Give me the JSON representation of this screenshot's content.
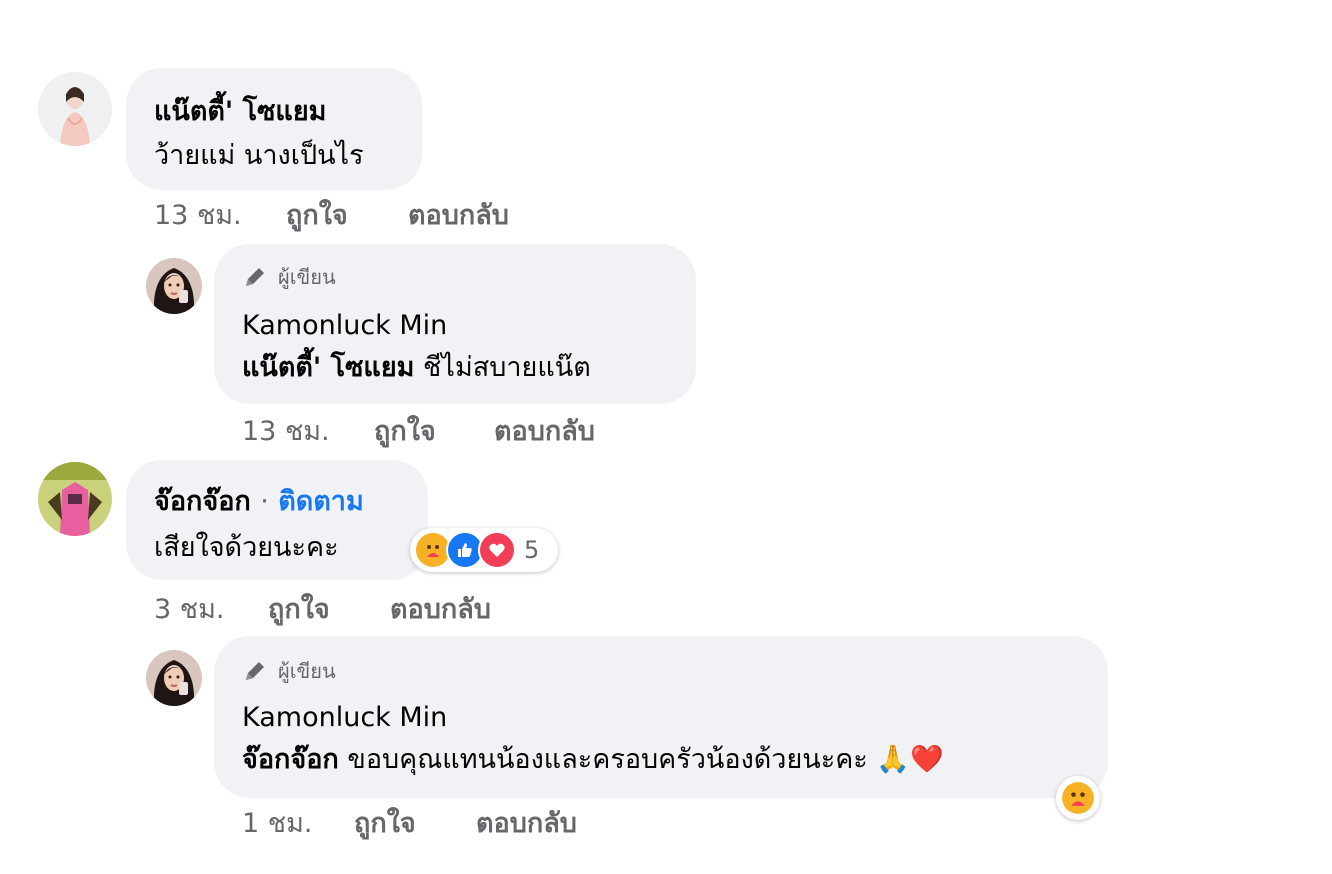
{
  "comments": [
    {
      "author": "แน๊ตตี้' โซแยม",
      "text": "ว้ายแม่ นางเป็นไร",
      "time": "13 ชม.",
      "like_label": "ถูกใจ",
      "reply_label": "ตอบกลับ"
    },
    {
      "author_badge": "ผู้เขียน",
      "author": "Kamonluck Min",
      "mention": "แน๊ตตี้' โซแยม",
      "text": "ชีไม่สบายแน๊ต",
      "time": "13 ชม.",
      "like_label": "ถูกใจ",
      "reply_label": "ตอบกลับ"
    },
    {
      "author": "จ๊อกจ๊อก",
      "separator": "·",
      "follow_label": "ติดตาม",
      "text": "เสียใจด้วยนะคะ",
      "reaction_count": "5",
      "reaction_icons": [
        "care-icon",
        "like-icon",
        "love-icon"
      ],
      "time": "3 ชม.",
      "like_label": "ถูกใจ",
      "reply_label": "ตอบกลับ"
    },
    {
      "author_badge": "ผู้เขียน",
      "author": "Kamonluck Min",
      "mention": "จ๊อกจ๊อก",
      "text": "ขอบคุณแทนน้องและครอบครัวน้องด้วยนะคะ",
      "emojis": "🙏❤️",
      "reaction_icons": [
        "care-icon"
      ],
      "time": "1 ชม.",
      "like_label": "ถูกใจ",
      "reply_label": "ตอบกลับ"
    }
  ],
  "colors": {
    "bubble": "#f0f2f5",
    "text": "#050505",
    "meta": "#65676b",
    "follow": "#1877f2",
    "like": "#1877f2",
    "love": "#f33e58",
    "care": "#f7b125"
  }
}
